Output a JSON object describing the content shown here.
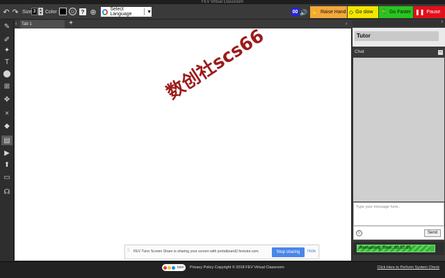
{
  "window": {
    "title": "FEV Virtual Classroom"
  },
  "toolbar": {
    "undo_icon": "undo-icon",
    "redo_icon": "redo-icon",
    "size_label": "Size:",
    "size_value": "3",
    "color_label": "Color :",
    "color_value": "#000000",
    "emoji_icon": "smiley-icon",
    "help_label": "?",
    "zoom_icon": "zoom-icon",
    "language_label": "Select Language",
    "language_arrow": "▼",
    "student_count": "00",
    "raise_hand_label": "Raise Hand",
    "go_slow_label": "Go slow",
    "go_faster_label": "Go Faster",
    "pause_label": "Pause"
  },
  "left_tools": [
    {
      "name": "pencil-icon",
      "glyph": "✎"
    },
    {
      "name": "highlighter-icon",
      "glyph": "✐"
    },
    {
      "name": "magic-wand-icon",
      "glyph": "✦"
    },
    {
      "name": "text-tool-icon",
      "glyph": "T"
    },
    {
      "name": "shapes-icon",
      "glyph": "⬤"
    },
    {
      "name": "graph-icon",
      "glyph": "⊞"
    },
    {
      "name": "move-icon",
      "glyph": "✥"
    },
    {
      "name": "close-icon",
      "glyph": "×"
    },
    {
      "name": "eraser-icon",
      "glyph": "◆"
    },
    {
      "name": "chart-icon",
      "glyph": "▤"
    },
    {
      "name": "video-icon",
      "glyph": "▶"
    },
    {
      "name": "upload-icon",
      "glyph": "⬆"
    },
    {
      "name": "screen-share-icon",
      "glyph": "▭"
    },
    {
      "name": "headset-icon",
      "glyph": "☊"
    }
  ],
  "tabs": {
    "active_label": "Tab 1",
    "add_label": "+",
    "prev_label": "‹",
    "next_label": "›"
  },
  "watermark": "数创社scs66",
  "screenshare": {
    "message": "FEV Tutor Screen Share is sharing your screen with portalboard2.fevtutor.com.",
    "stop_label": "Stop sharing",
    "hide_label": "Hide"
  },
  "right_panel": {
    "scroll_arrow": "›",
    "tutor_label": "Tutor",
    "chat_label": "Chat",
    "chat_collapse": "–",
    "chat_placeholder": "Type your message here..",
    "send_label": "Send",
    "remaining_time_text": "Remaining Time: 00:57:05",
    "remaining_time_fraction": 0.95
  },
  "footer": {
    "logo_text": "tutor",
    "text": "Privacy Policy Copyright © 2018 FEV Virtual Classroom",
    "system_check_link": "Click Here to Perform System Check"
  },
  "colors": {
    "raise_hand": "#f4a83a",
    "go_slow": "#f2e600",
    "go_faster": "#29c51e",
    "pause": "#e2101a",
    "stop_sharing": "#4a86e8",
    "timer": "#3cbd3c"
  }
}
